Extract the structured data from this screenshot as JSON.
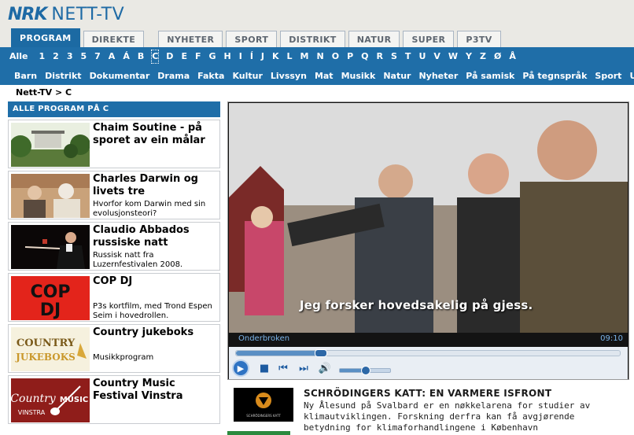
{
  "logo": {
    "brand": "NRK",
    "product": "NETT-TV"
  },
  "tabs": [
    {
      "label": "PROGRAM",
      "active": true
    },
    {
      "label": "DIREKTE",
      "active": false
    },
    {
      "label": "NYHETER",
      "active": false
    },
    {
      "label": "SPORT",
      "active": false
    },
    {
      "label": "DISTRIKT",
      "active": false
    },
    {
      "label": "NATUR",
      "active": false
    },
    {
      "label": "SUPER",
      "active": false
    },
    {
      "label": "P3TV",
      "active": false
    }
  ],
  "alphabet": [
    "Alle",
    "1",
    "2",
    "3",
    "5",
    "7",
    "A",
    "Á",
    "B",
    "C",
    "D",
    "E",
    "F",
    "G",
    "H",
    "I",
    "Í",
    "J",
    "K",
    "L",
    "M",
    "N",
    "O",
    "P",
    "Q",
    "R",
    "S",
    "T",
    "U",
    "V",
    "W",
    "Y",
    "Z",
    "Ø",
    "Å"
  ],
  "alphabet_selected": "C",
  "categories": [
    "Barn",
    "Distrikt",
    "Dokumentar",
    "Drama",
    "Fakta",
    "Kultur",
    "Livssyn",
    "Mat",
    "Musikk",
    "Natur",
    "Nyheter",
    "På samisk",
    "På tegnspråk",
    "Sport",
    "Unde"
  ],
  "breadcrumb": "Nett-TV > C",
  "left": {
    "heading": "ALLE PROGRAM PÅ C",
    "items": [
      {
        "title": "Chaim Soutine - på sporet av ein målar",
        "desc": ""
      },
      {
        "title": "Charles Darwin og livets tre",
        "desc": "Hvorfor kom Darwin med sin evolusjonsteori?"
      },
      {
        "title": "Claudio Abbados russiske natt",
        "desc": "Russisk natt fra Luzernfestivalen 2008."
      },
      {
        "title": "COP DJ",
        "desc": "P3s kortfilm, med Trond Espen Seim i hovedrollen."
      },
      {
        "title": "Country jukeboks",
        "desc": "Musikkprogram"
      },
      {
        "title": "Country Music Festival Vinstra",
        "desc": ""
      }
    ]
  },
  "player": {
    "subtitle": "Jeg forsker hovedsakelig på gjess.",
    "program_name": "Onderbroken",
    "duration": "09:10",
    "progress": 0.22,
    "volume": 0.5
  },
  "feature": {
    "title": "SCHRÖDINGERS KATT: EN VARMERE ISFRONT",
    "desc": "Ny Ålesund på Svalbard er en nøkkelarena for studier av klimautviklingen. Forskning derfra kan få avgjørende betydning for klimaforhandlingene i København",
    "thumb_caption": "SCHRÖDINGERS KATT"
  },
  "thumb_labels": {
    "cop": "COP",
    "dj": "DJ",
    "country": "COUNTRY",
    "jukeboks": "JUKEBOKS",
    "cmf_country": "Country",
    "cmf_music": "MUSIC",
    "cmf_vinstra": "VINSTRA"
  },
  "colors": {
    "brand_blue": "#1f6ea8",
    "logo_blue": "#1e6aa5",
    "player_text": "#7ab3e8"
  }
}
